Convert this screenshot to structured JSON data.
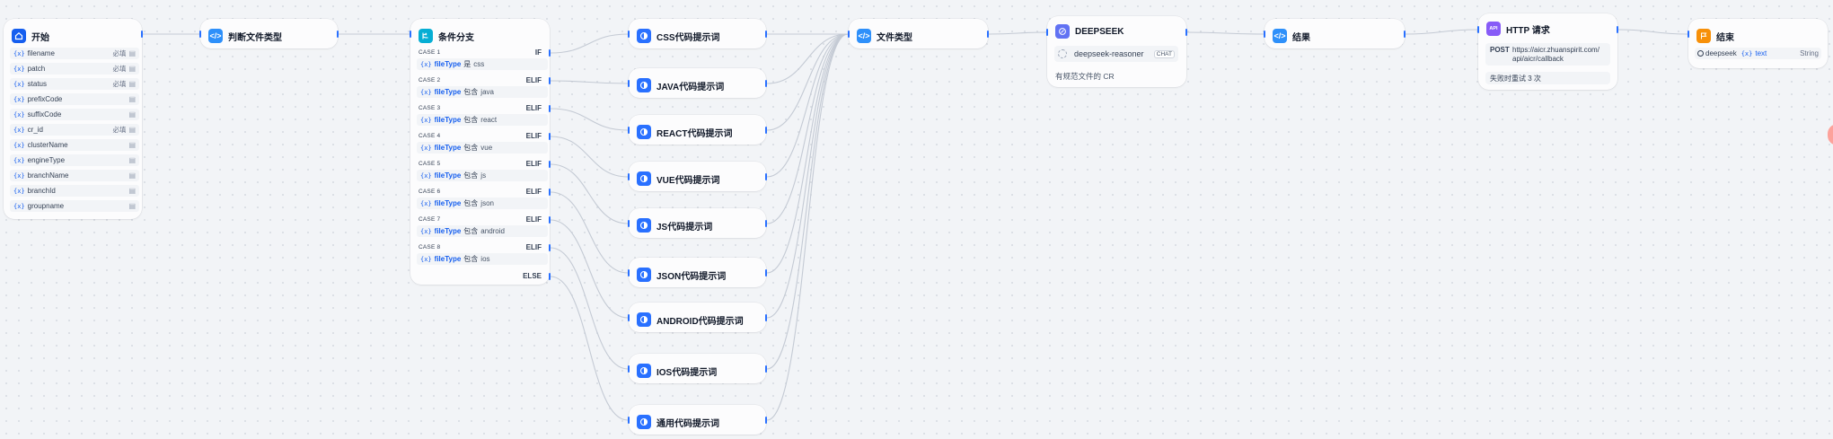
{
  "nodes": {
    "start": {
      "title": "开始",
      "vars": [
        {
          "name": "filename",
          "required": "必填",
          "icon": "text-type-icon"
        },
        {
          "name": "patch",
          "required": "必填",
          "icon": "text-type-icon"
        },
        {
          "name": "status",
          "required": "必填",
          "icon": "text-type-icon"
        },
        {
          "name": "prefixCode",
          "required": "",
          "icon": "text-type-icon"
        },
        {
          "name": "suffixCode",
          "required": "",
          "icon": "text-type-icon"
        },
        {
          "name": "cr_id",
          "required": "必填",
          "icon": "text-type-icon"
        },
        {
          "name": "clusterName",
          "required": "",
          "icon": "text-type-icon"
        },
        {
          "name": "engineType",
          "required": "",
          "icon": "text-type-icon"
        },
        {
          "name": "branchName",
          "required": "",
          "icon": "text-type-icon"
        },
        {
          "name": "branchId",
          "required": "",
          "icon": "text-type-icon"
        },
        {
          "name": "groupname",
          "required": "",
          "icon": "text-type-icon"
        }
      ]
    },
    "judge": {
      "title": "判断文件类型"
    },
    "ifelse": {
      "title": "条件分支",
      "cases": [
        {
          "label": "CASE 1",
          "kw": "IF",
          "var": "fileType",
          "op": "是",
          "val": "css"
        },
        {
          "label": "CASE 2",
          "kw": "ELIF",
          "var": "fileType",
          "op": "包含",
          "val": "java"
        },
        {
          "label": "CASE 3",
          "kw": "ELIF",
          "var": "fileType",
          "op": "包含",
          "val": "react"
        },
        {
          "label": "CASE 4",
          "kw": "ELIF",
          "var": "fileType",
          "op": "包含",
          "val": "vue"
        },
        {
          "label": "CASE 5",
          "kw": "ELIF",
          "var": "fileType",
          "op": "包含",
          "val": "js"
        },
        {
          "label": "CASE 6",
          "kw": "ELIF",
          "var": "fileType",
          "op": "包含",
          "val": "json"
        },
        {
          "label": "CASE 7",
          "kw": "ELIF",
          "var": "fileType",
          "op": "包含",
          "val": "android"
        },
        {
          "label": "CASE 8",
          "kw": "ELIF",
          "var": "fileType",
          "op": "包含",
          "val": "ios"
        }
      ],
      "else_kw": "ELSE"
    },
    "prompts": [
      {
        "title": "CSS代码提示词"
      },
      {
        "title": "JAVA代码提示词"
      },
      {
        "title": "REACT代码提示词"
      },
      {
        "title": "VUE代码提示词"
      },
      {
        "title": "JS代码提示词"
      },
      {
        "title": "JSON代码提示词"
      },
      {
        "title": "ANDROID代码提示词"
      },
      {
        "title": "IOS代码提示词"
      },
      {
        "title": "通用代码提示词"
      }
    ],
    "filetype": {
      "title": "文件类型"
    },
    "llm": {
      "title": "DEEPSEEK",
      "model": "deepseek-reasoner",
      "mode": "CHAT",
      "desc": "有规范文件的 CR"
    },
    "result": {
      "title": "结果"
    },
    "http": {
      "title": "HTTP 请求",
      "method": "POST",
      "url_line1": "https://aicr.zhuanspirit.com/",
      "url_line2": "api/aicr/callback",
      "retry": "失败时重试 3 次"
    },
    "end": {
      "title": "结束",
      "output_node": "deepseek",
      "output_var": "text",
      "output_type": "String"
    }
  },
  "colors": {
    "accent": "#2970ff",
    "start_icon": "#155eef",
    "code_icon": "#2e90fa",
    "ifelse_icon": "#06aed4",
    "template_icon": "#2970ff",
    "llm_icon": "#6172f3",
    "http_icon": "#875bf7",
    "end_icon": "#f79009"
  }
}
